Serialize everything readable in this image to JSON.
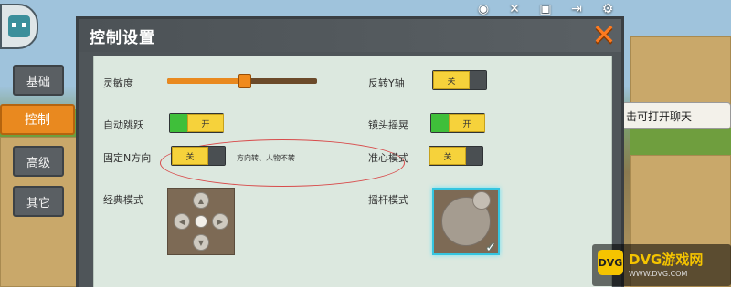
{
  "dialog": {
    "title": "控制设置",
    "close_icon": "close-x-icon"
  },
  "tabs": [
    {
      "label": "基础",
      "active": false
    },
    {
      "label": "控制",
      "active": true
    },
    {
      "label": "高级",
      "active": false
    },
    {
      "label": "其它",
      "active": false
    }
  ],
  "settings": {
    "sensitivity": {
      "label": "灵敏度",
      "value_fraction": 0.52
    },
    "invert_y": {
      "label": "反转Y轴",
      "toggle": "关",
      "state": "off"
    },
    "auto_jump": {
      "label": "自动跳跃",
      "toggle": "开",
      "state": "on"
    },
    "camera_shake": {
      "label": "镜头摇晃",
      "toggle": "开",
      "state": "on"
    },
    "fixed_direction": {
      "label": "固定N方向",
      "toggle": "关",
      "state": "off",
      "note": "方向转、人物不转"
    },
    "crosshair_mode": {
      "label": "准心模式",
      "toggle": "关",
      "state": "off"
    },
    "classic_mode": {
      "label": "经典模式",
      "icon": "dpad-icon"
    },
    "joystick_mode": {
      "label": "摇杆模式",
      "icon": "joystick-icon",
      "selected": true
    }
  },
  "game": {
    "chat_hint": "击可打开聊天",
    "top_icons": [
      "camera-icon",
      "tools-icon",
      "screen-icon",
      "exit-icon",
      "settings-icon"
    ]
  },
  "watermark": {
    "icon_text": "DVG",
    "text": "DVG游戏网",
    "url": "WWW.DVG.COM"
  },
  "colors": {
    "accent": "#e9891f",
    "toggle_yellow": "#f6d23b",
    "toggle_green": "#3fbf3a",
    "panel": "#dce8df",
    "selection": "#35c5e0"
  }
}
